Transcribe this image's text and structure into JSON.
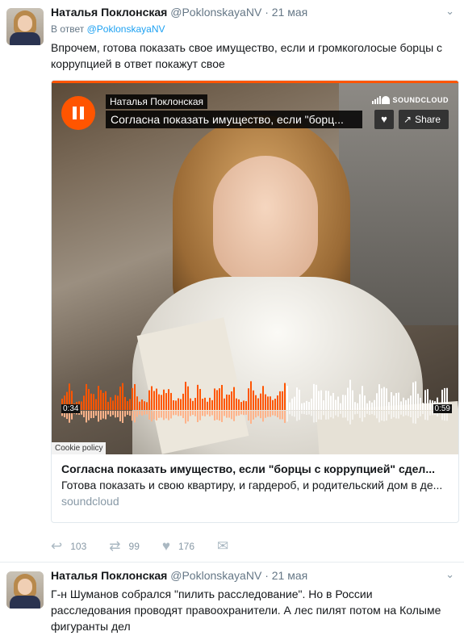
{
  "tweet1": {
    "name": "Наталья Поклонская",
    "handle": "@PoklonskayaNV",
    "dot": "·",
    "date": "21 мая",
    "reply_prefix": "В ответ",
    "reply_handle": "@PoklonskayaNV",
    "text": "Впрочем, готова показать свое имущество, если и громкоголосые борцы с коррупцией в ответ покажут свое",
    "player": {
      "artist": "Наталья Поклонская",
      "track": "Согласна показать имущество, если \"борц...",
      "brand": "SOUNDCLOUD",
      "share_label": "Share",
      "current_time": "0:34",
      "duration": "0:59",
      "progress": 0.576,
      "cookie_policy": "Cookie policy",
      "accent_color": "#ff5500"
    },
    "card": {
      "title": "Согласна показать имущество, если \"борцы с коррупцией\" сдел...",
      "description": "Готова показать и свою квартиру, и гардероб, и родительский дом в де...",
      "domain": "soundcloud"
    },
    "actions": {
      "reply_count": "103",
      "retweet_count": "99",
      "like_count": "176"
    }
  },
  "tweet2": {
    "name": "Наталья Поклонская",
    "handle": "@PoklonskayaNV",
    "dot": "·",
    "date": "21 мая",
    "text": "Г-н Шуманов собрался \"пилить расследование\". Но в России расследования проводят правоохранители. А лес пилят потом на Колыме фигуранты дел"
  },
  "icons": {
    "caret": "chevron-down-icon",
    "reply": "reply-icon",
    "retweet": "retweet-icon",
    "like": "heart-icon",
    "dm": "envelope-icon"
  }
}
